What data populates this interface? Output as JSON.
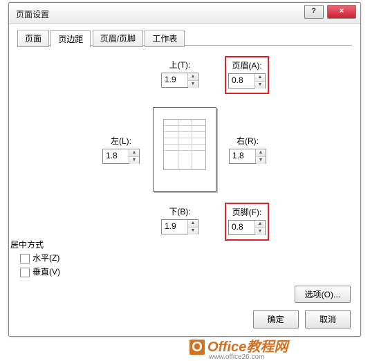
{
  "dialog": {
    "title": "页面设置"
  },
  "tabs": {
    "page": "页面",
    "margins": "页边距",
    "headerfooter": "页眉/页脚",
    "sheet": "工作表"
  },
  "fields": {
    "top": {
      "label": "上(T):",
      "value": "1.9"
    },
    "header": {
      "label": "页眉(A):",
      "value": "0.8"
    },
    "left": {
      "label": "左(L):",
      "value": "1.8"
    },
    "right": {
      "label": "右(R):",
      "value": "1.8"
    },
    "bottom": {
      "label": "下(B):",
      "value": "1.9"
    },
    "footer": {
      "label": "页脚(F):",
      "value": "0.8"
    }
  },
  "center": {
    "section": "居中方式",
    "horizontal": "水平(Z)",
    "vertical": "垂直(V)"
  },
  "buttons": {
    "options": "选项(O)...",
    "ok": "确定",
    "cancel": "取消"
  },
  "watermark": {
    "brand": "Office教程网",
    "url": "www.office26.com"
  }
}
